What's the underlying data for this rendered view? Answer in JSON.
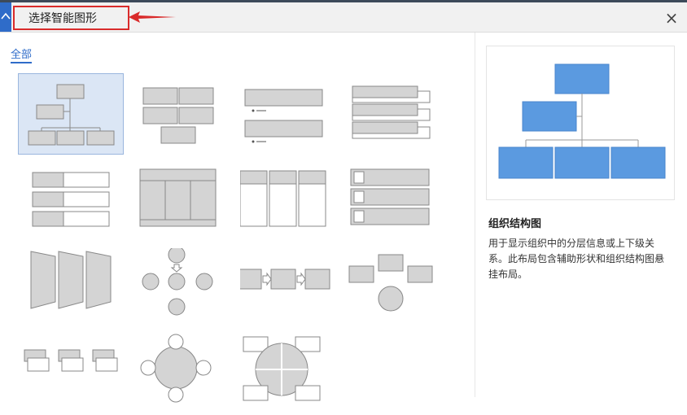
{
  "dialog": {
    "title": "选择智能图形",
    "close_label": "×",
    "app_icon": "app-logo-icon"
  },
  "categories": [
    {
      "label": "全部",
      "selected": true
    }
  ],
  "thumbnails": [
    {
      "name": "organization-chart",
      "selected": true
    },
    {
      "name": "grid-blocks",
      "selected": false
    },
    {
      "name": "stacked-list",
      "selected": false
    },
    {
      "name": "bracket-list",
      "selected": false
    },
    {
      "name": "vertical-bullet-list",
      "selected": false
    },
    {
      "name": "table-hierarchy",
      "selected": false
    },
    {
      "name": "vertical-box-list",
      "selected": false
    },
    {
      "name": "picture-caption-list",
      "selected": false
    },
    {
      "name": "shape-process",
      "selected": false
    },
    {
      "name": "converging-radial",
      "selected": false
    },
    {
      "name": "basic-process",
      "selected": false
    },
    {
      "name": "converging-arrows",
      "selected": false
    },
    {
      "name": "step-down-process",
      "selected": false
    },
    {
      "name": "radial-circles",
      "selected": false
    },
    {
      "name": "segmented-cycle",
      "selected": false
    }
  ],
  "preview": {
    "title": "组织结构图",
    "description": "用于显示组织中的分层信息或上下级关系。此布局包含辅助形状和组织结构图悬挂布局。"
  },
  "colors": {
    "accent": "#2f6cc9",
    "highlight": "#d92b2b",
    "shape_fill": "#d4d4d4",
    "preview_fill": "#5b9ae0"
  }
}
